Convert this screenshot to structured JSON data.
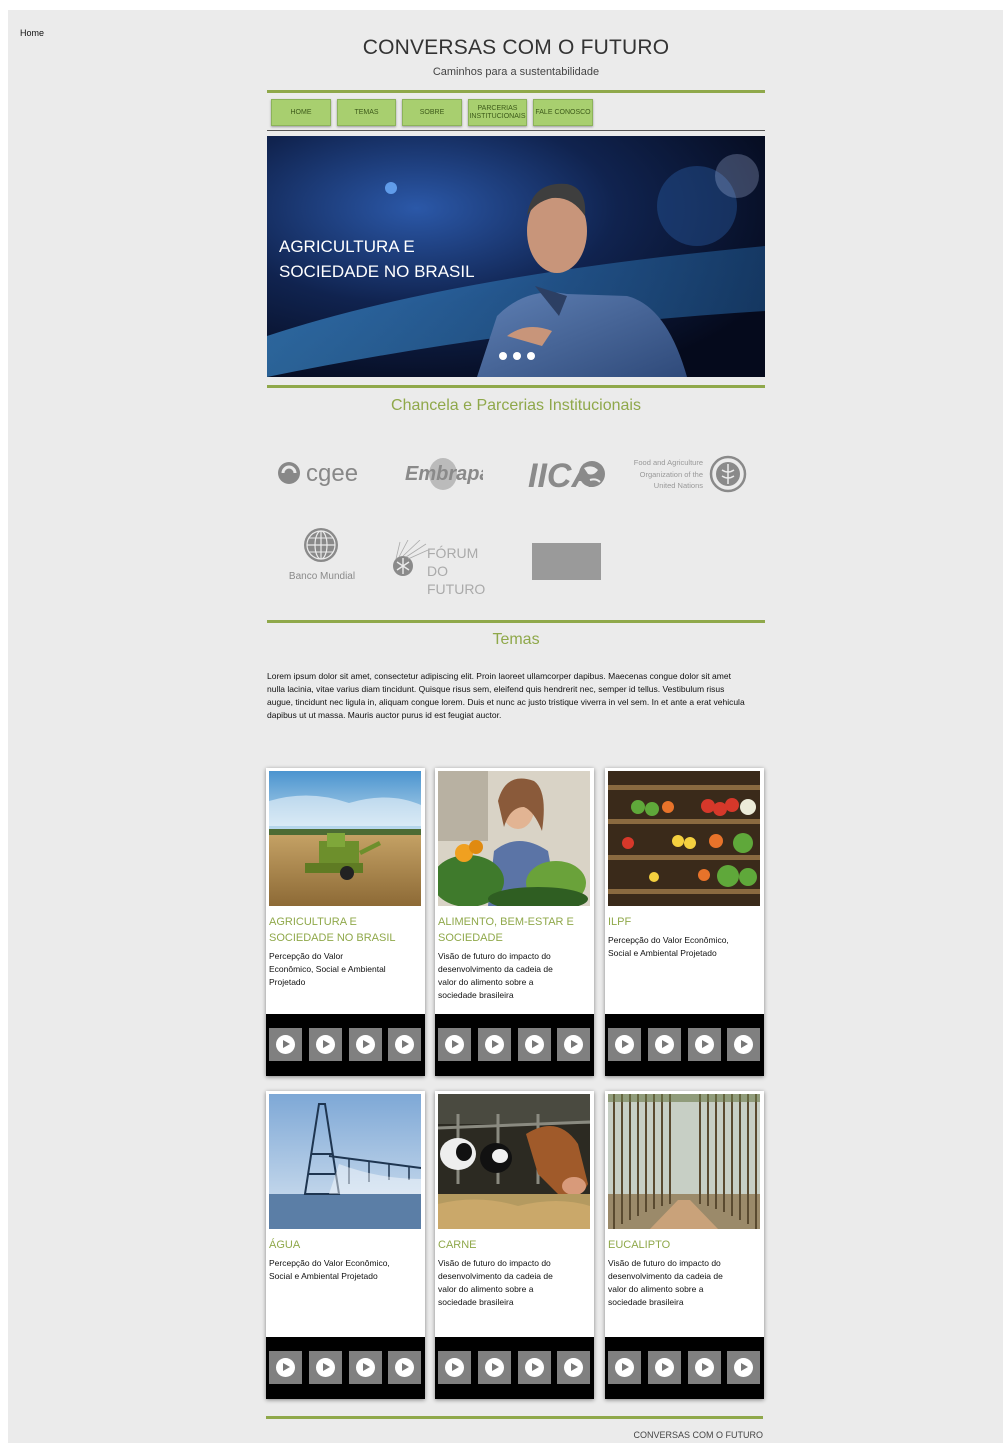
{
  "home_link": "Home",
  "header": {
    "title": "CONVERSAS COM O FUTURO",
    "subtitle": "Caminhos para a sustentabilidade"
  },
  "nav": {
    "home": "HOME",
    "temas": "TEMAS",
    "sobre": "SOBRE",
    "parcerias": "PARCERIAS INSTITUCIONAIS",
    "fale": "FALE CONOSCO"
  },
  "hero": {
    "caption_line1": "AGRICULTURA E",
    "caption_line2": "SOCIEDADE NO BRASIL",
    "slide_count": 3
  },
  "partners": {
    "title": "Chancela e  Parcerias Institucionais",
    "cgee": "cgee",
    "embrapa": "Embrapa",
    "iica": "IICA",
    "fao_line1": "Food and Agriculture",
    "fao_line2": "Organization of the",
    "fao_line3": "United Nations",
    "banco_mundial": "Banco Mundial",
    "forum_line1": "FÓRUM DO",
    "forum_line2": "FUTURO"
  },
  "temas": {
    "title": "Temas",
    "text": "Lorem ipsum dolor sit amet, consectetur adipiscing elit. Proin laoreet ullamcorper dapibus. Maecenas congue dolor sit amet nulla lacinia, vitae varius diam tincidunt. Quisque risus sem, eleifend quis hendrerit nec, semper id tellus. Vestibulum risus augue, tincidunt nec ligula in, aliquam congue lorem. Duis et nunc ac justo tristique viverra in vel sem. In et ante a erat vehicula dapibus ut ut massa. Mauris auctor purus id est feugiat auctor."
  },
  "cards": [
    {
      "title_line1": "AGRICULTURA E",
      "title_line2": "SOCIEDADE NO BRASIL",
      "desc": "Percepção do Valor Econômico, Social e Ambiental Projetado"
    },
    {
      "title_line1": "ALIMENTO, BEM-ESTAR E",
      "title_line2": "SOCIEDADE",
      "desc": "Visão de futuro do impacto do desenvolvimento da cadeia de valor do alimento sobre a sociedade brasileira"
    },
    {
      "title_line1": "ILPF",
      "title_line2": "",
      "desc": "Percepção do Valor Econômico, Social e Ambiental Projetado"
    },
    {
      "title_line1": "ÁGUA",
      "title_line2": "",
      "desc": "Percepção do Valor Econômico, Social e Ambiental Projetado"
    },
    {
      "title_line1": "CARNE",
      "title_line2": "",
      "desc": "Visão de futuro do impacto do desenvolvimento da cadeia de valor do alimento sobre a sociedade brasileira"
    },
    {
      "title_line1": "EUCALIPTO",
      "title_line2": "",
      "desc": "Visão de futuro do impacto do desenvolvimento da cadeia de valor do alimento sobre a sociedade brasileira"
    }
  ],
  "footer": {
    "text": "CONVERSAS COM O FUTURO"
  },
  "colors": {
    "accent_green": "#8fa84a",
    "nav_green": "#a8cf6f",
    "page_bg": "#ebebeb"
  }
}
